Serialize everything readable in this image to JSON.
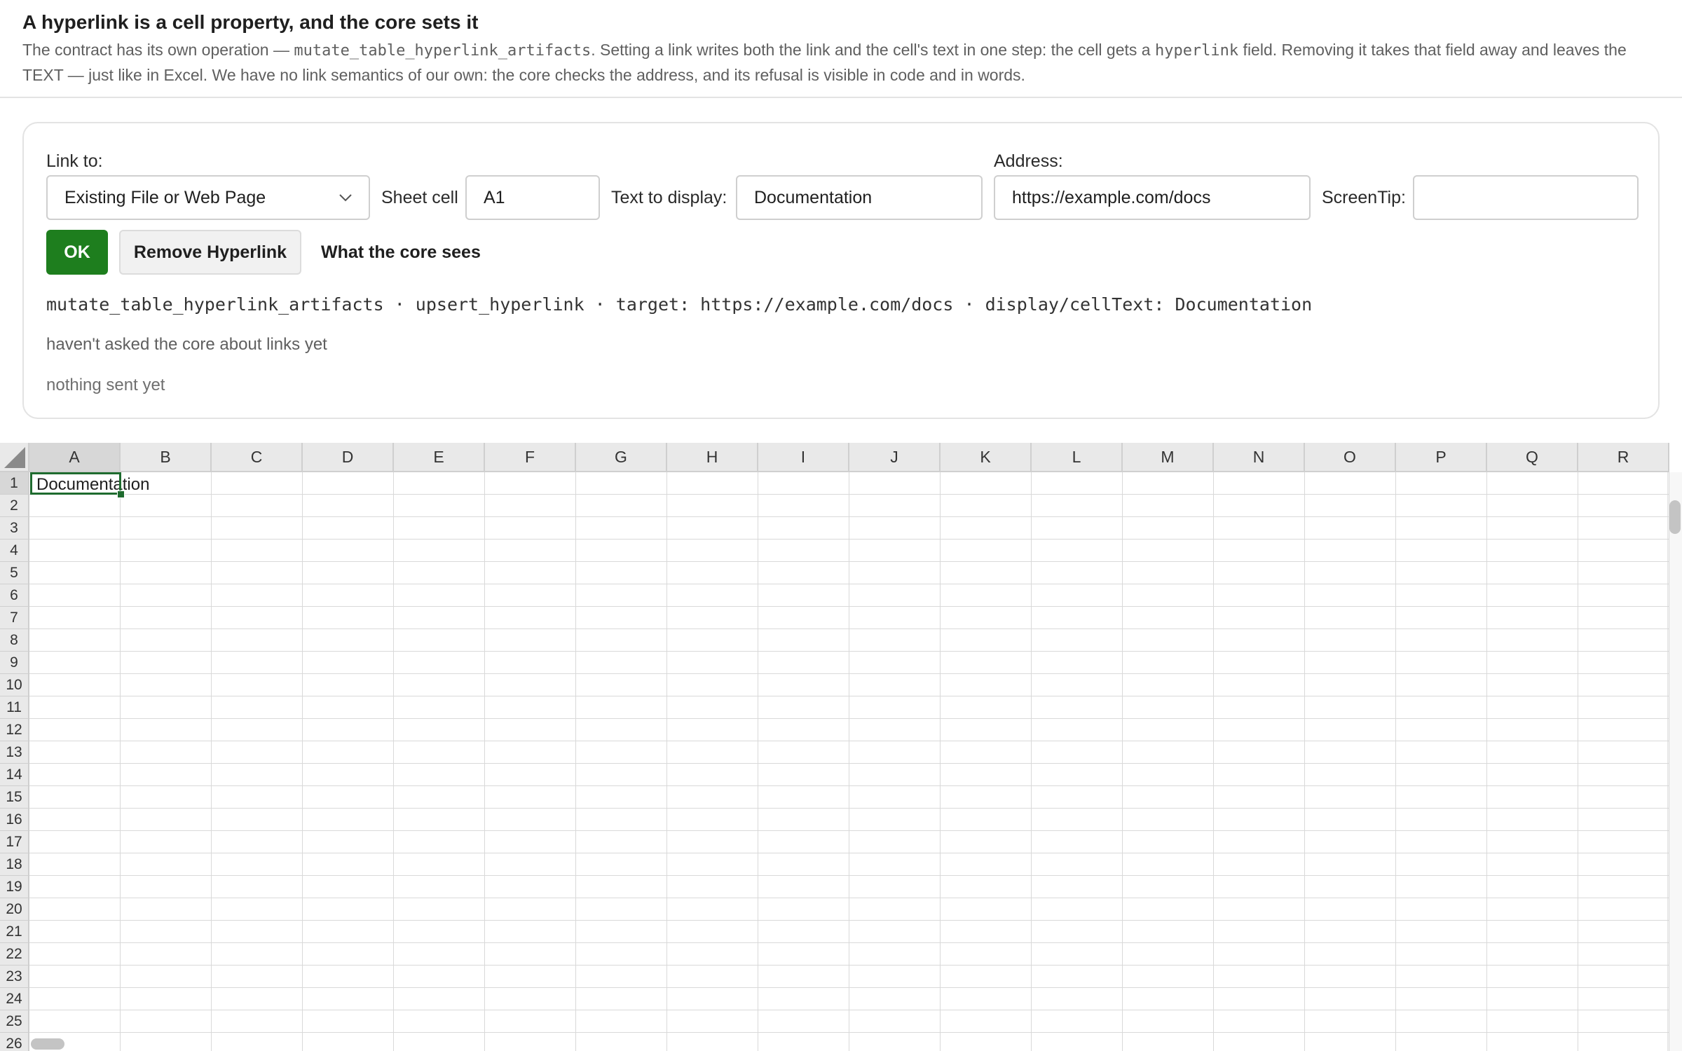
{
  "header": {
    "title": "A hyperlink is a cell property, and the core sets it",
    "desc_part1": "The contract has its own operation — ",
    "desc_code1": "mutate_table_hyperlink_artifacts",
    "desc_part2": ". Setting a link writes both the link and the cell's text in one step: the cell gets a ",
    "desc_code2": "hyperlink",
    "desc_part3": " field. Removing it takes that field away and leaves the TEXT — just like in Excel. We have no link semantics of our own: the core checks the address, and its refusal is visible in code and in words."
  },
  "form": {
    "link_to_label": "Link to:",
    "link_to_value": "Existing File or Web Page",
    "sheet_cell_label": "Sheet cell",
    "sheet_cell_value": "A1",
    "text_display_label": "Text to display:",
    "text_display_value": "Documentation",
    "address_label": "Address:",
    "address_value": "https://example.com/docs",
    "screentip_label": "ScreenTip:",
    "screentip_value": ""
  },
  "actions": {
    "ok_label": "OK",
    "remove_label": "Remove Hyperlink",
    "core_label": "What the core sees"
  },
  "preview": {
    "code": "mutate_table_hyperlink_artifacts · upsert_hyperlink · target: https://example.com/docs · display/cellText: Documentation",
    "status_links": "haven't asked the core about links yet",
    "status_sent": "nothing sent yet"
  },
  "sheet": {
    "columns": [
      "A",
      "B",
      "C",
      "D",
      "E",
      "F",
      "G",
      "H",
      "I",
      "J",
      "K",
      "L",
      "M",
      "N",
      "O",
      "P",
      "Q",
      "R"
    ],
    "rows": [
      "1",
      "2",
      "3",
      "4",
      "5",
      "6",
      "7",
      "8",
      "9",
      "10",
      "11",
      "12",
      "13",
      "14",
      "15",
      "16",
      "17",
      "18",
      "19",
      "20",
      "21",
      "22",
      "23",
      "24",
      "25",
      "26"
    ],
    "selected_cell": "A1",
    "a1_text": "Documentation"
  },
  "colors": {
    "accent": "#1e7e1e",
    "selection": "#1e6b2e"
  }
}
